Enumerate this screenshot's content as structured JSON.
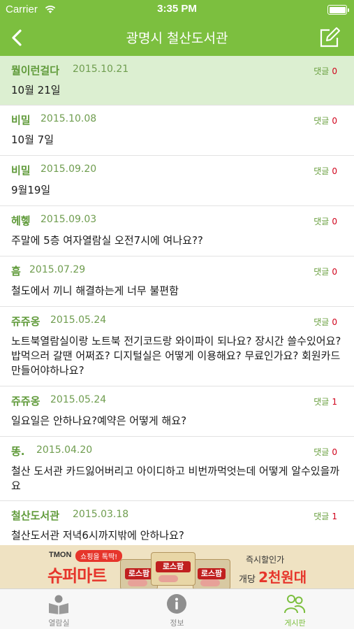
{
  "status_bar": {
    "carrier": "Carrier",
    "time": "3:35 PM"
  },
  "nav": {
    "title": "광명시 철산도서관"
  },
  "comment_label": "댓글",
  "posts": [
    {
      "author": "뭘이런걸다",
      "date": "2015.10.21",
      "comments": "0",
      "body": "10월 21일"
    },
    {
      "author": "비밀",
      "date": "2015.10.08",
      "comments": "0",
      "body": "10월 7일"
    },
    {
      "author": "비밀",
      "date": "2015.09.20",
      "comments": "0",
      "body": "9월19일"
    },
    {
      "author": "헤헿",
      "date": "2015.09.03",
      "comments": "0",
      "body": "주말에 5층 여자열람실 오전7시에 여나요??"
    },
    {
      "author": "흠",
      "date": "2015.07.29",
      "comments": "0",
      "body": "철도에서 끼니 해결하는게 너무 불편함"
    },
    {
      "author": "쥬쥬옹",
      "date": "2015.05.24",
      "comments": "0",
      "body": "노트북열람실이랑 노트북 전기코드랑 와이파이 되나요? 장시간 쓸수있어요? 밥먹으러 갈땐 어쩌죠? 디지털실은 어떻게 이용해요? 무료인가요? 회원카드 만들어야하나요?"
    },
    {
      "author": "쥬쥬옹",
      "date": "2015.05.24",
      "comments": "1",
      "body": "일요일은 안하나요?예약은 어떻게 해요?"
    },
    {
      "author": "똥.",
      "date": "2015.04.20",
      "comments": "0",
      "body": "철산 도서관 카드잃어버리고 아이디하고 비번까먹엇는데 어떻게 알수있을까요"
    },
    {
      "author": "철산도서관",
      "date": "2015.03.18",
      "comments": "1",
      "body": "철산도서관 저녁6시까지밖에 안하나요?"
    }
  ],
  "ad": {
    "tmon": "TMON",
    "badge": "쇼핑을 톡딱!",
    "brand": "슈퍼마트",
    "product": "로스팜",
    "sub": "즉시할인가",
    "promo_prefix": "개당",
    "promo_value": "2천원대"
  },
  "tabs": [
    {
      "label": "열람실",
      "icon": "reading-room-icon"
    },
    {
      "label": "정보",
      "icon": "info-icon"
    },
    {
      "label": "게시판",
      "icon": "community-icon",
      "active": true
    }
  ],
  "colors": {
    "brand_green": "#7cbf3f",
    "highlight": "#dcefd1",
    "comment_count": "#d0021b"
  }
}
